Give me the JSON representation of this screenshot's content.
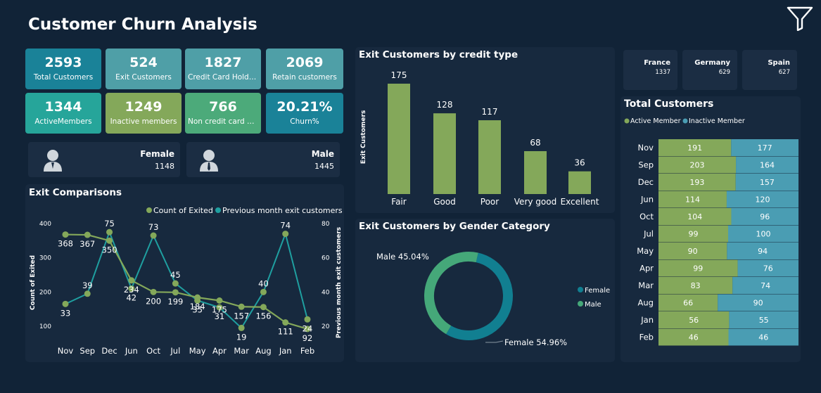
{
  "page": {
    "title": "Customer Churn Analysis"
  },
  "kpis": [
    {
      "value": "2593",
      "label": "Total Customers",
      "color": "#1a8298"
    },
    {
      "value": "524",
      "label": "Exit Customers",
      "color": "#4f9fa7"
    },
    {
      "value": "1827",
      "label": "Credit Card Holders",
      "color": "#4f9fa7"
    },
    {
      "value": "2069",
      "label": "Retain customers",
      "color": "#4f9fa7"
    },
    {
      "value": "1344",
      "label": "ActiveMembers",
      "color": "#26a59a"
    },
    {
      "value": "1249",
      "label": "Inactive members",
      "color": "#84a85a"
    },
    {
      "value": "766",
      "label": "Non credit card h...",
      "color": "#4caa7a"
    },
    {
      "value": "20.21%",
      "label": "Churn%",
      "color": "#1a8298"
    }
  ],
  "gender_cards": {
    "female": {
      "label": "Female",
      "value": "1148"
    },
    "male": {
      "label": "Male",
      "value": "1445"
    }
  },
  "countries": [
    {
      "name": "France",
      "count": "1337"
    },
    {
      "name": "Germany",
      "count": "629"
    },
    {
      "name": "Spain",
      "count": "627"
    }
  ],
  "colors": {
    "green": "#84a85a",
    "teal": "#1f9fa0",
    "blue": "#4a9db3",
    "darkteal": "#117f91",
    "mint": "#45a879"
  },
  "chart_data": [
    {
      "type": "line",
      "title": "Exit Comparisons",
      "x": [
        "Nov",
        "Sep",
        "Dec",
        "Jun",
        "Oct",
        "Jul",
        "May",
        "Apr",
        "Mar",
        "Aug",
        "Jan",
        "Feb"
      ],
      "ylabel": "Count of Exited",
      "y2label": "Previous month exit customers",
      "ylim": [
        50,
        400
      ],
      "y2lim": [
        15,
        80
      ],
      "yticks": [
        100,
        200,
        300,
        400
      ],
      "y2ticks": [
        20,
        40,
        60,
        80
      ],
      "legend": "top-right",
      "series": [
        {
          "name": "Count of Exited",
          "axis": "left",
          "values": [
            368,
            367,
            350,
            234,
            200,
            199,
            184,
            175,
            157,
            156,
            111,
            92
          ]
        },
        {
          "name": "Previous month exit customers",
          "axis": "right",
          "values": [
            33,
            39,
            75,
            42,
            73,
            45,
            35,
            31,
            19,
            40,
            74,
            24
          ]
        }
      ]
    },
    {
      "type": "bar",
      "title": "Exit Customers by credit type",
      "categories": [
        "Fair",
        "Good",
        "Poor",
        "Very good",
        "Excellent"
      ],
      "values": [
        175,
        128,
        117,
        68,
        36
      ],
      "ylabel": "Exit Customers",
      "ylim": [
        0,
        175
      ]
    },
    {
      "type": "pie",
      "title": "Exit Customers by Gender Category",
      "labels": [
        "Female",
        "Male"
      ],
      "values": [
        54.96,
        45.04
      ],
      "value_labels": [
        "Female 54.96%",
        "Male 45.04%"
      ],
      "legend": "right"
    },
    {
      "type": "bar",
      "title": "Total Customers",
      "orientation": "horizontal-stacked-100",
      "categories": [
        "Nov",
        "Sep",
        "Dec",
        "Jun",
        "Oct",
        "Jul",
        "May",
        "Apr",
        "Mar",
        "Aug",
        "Jan",
        "Feb"
      ],
      "legend": "top-left",
      "series": [
        {
          "name": "Active Member",
          "values": [
            191,
            203,
            193,
            114,
            104,
            99,
            90,
            99,
            83,
            66,
            56,
            46
          ]
        },
        {
          "name": "Inactive Member",
          "values": [
            177,
            164,
            157,
            120,
            96,
            100,
            94,
            76,
            74,
            90,
            55,
            46
          ]
        }
      ]
    }
  ]
}
